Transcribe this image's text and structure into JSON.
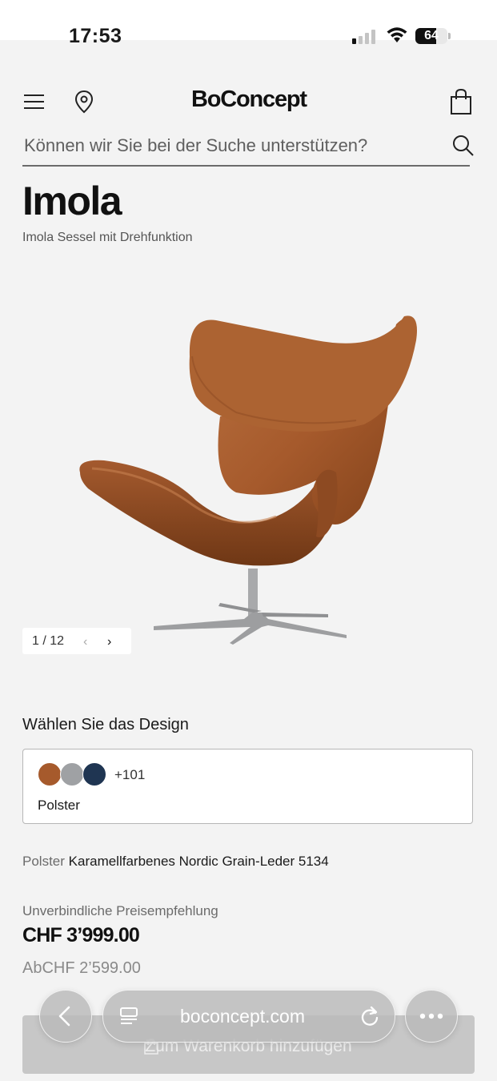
{
  "status": {
    "time": "17:53",
    "battery": "64"
  },
  "header": {
    "logo": "BoConcept",
    "search_placeholder": "Können wir Sie bei der Suche unterstützen?"
  },
  "product": {
    "title": "Imola",
    "subtitle": "Imola Sessel mit Drehfunktion",
    "gallery_position": "1 / 12"
  },
  "design": {
    "heading": "Wählen Sie das Design",
    "more_count": "+101",
    "option_label": "Polster",
    "swatch_colors": [
      "#a65a2c",
      "#9fa1a4",
      "#1f3552"
    ]
  },
  "material": {
    "key": "Polster",
    "value": "Karamellfarbenes Nordic Grain-Leder 5134"
  },
  "pricing": {
    "uvp_label": "Unverbindliche Preisempfehlung",
    "price": "CHF 3’999.00",
    "price_from": "AbCHF 2’599.00"
  },
  "cart": {
    "label": "Zum Warenkorb hinzufügen"
  },
  "browser": {
    "url": "boconcept.com"
  },
  "colors": {
    "accent": "#111111",
    "leather": "#a65a2c",
    "cart_button": "#c7c7c7"
  }
}
